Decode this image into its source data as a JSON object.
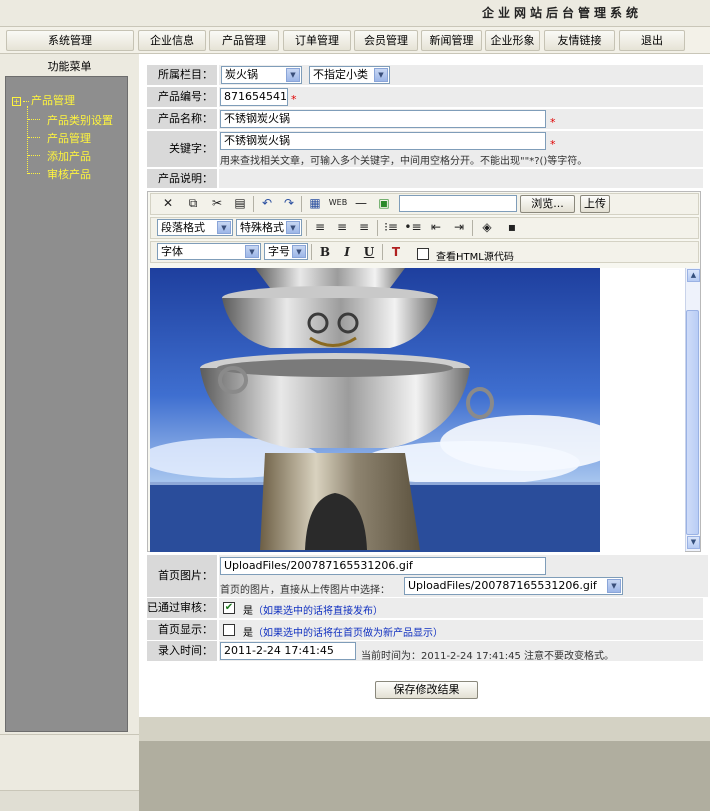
{
  "header": {
    "system_title": "企业网站后台管理系统"
  },
  "nav": {
    "items": [
      {
        "label": "系统管理"
      },
      {
        "label": "企业信息"
      },
      {
        "label": "产品管理"
      },
      {
        "label": "订单管理"
      },
      {
        "label": "会员管理"
      },
      {
        "label": "新闻管理"
      },
      {
        "label": "企业形象"
      },
      {
        "label": "友情链接"
      },
      {
        "label": "退出"
      }
    ]
  },
  "sidebar": {
    "title": "功能菜单",
    "root": {
      "label": "产品管理",
      "expander": "+"
    },
    "items": [
      {
        "label": "产品类别设置"
      },
      {
        "label": "产品管理"
      },
      {
        "label": "添加产品"
      },
      {
        "label": "审核产品"
      }
    ]
  },
  "form": {
    "category_label": "所属栏目：",
    "category_value": "炭火锅",
    "subcategory_value": "不指定小类",
    "code_label": "产品编号：",
    "code_value": "8716545416",
    "name_label": "产品名称：",
    "name_value": "不锈钢炭火锅",
    "keywords_label": "关键字：",
    "keywords_value": "不锈钢炭火锅",
    "keywords_hint": "用来查找相关文章，可输入多个关键字，中间用空格分开。不能出现\"\"*?()等字符。",
    "description_label": "产品说明：",
    "required_mark": "*",
    "image_label": "首页图片：",
    "image_value": "UploadFiles/200787165531206.gif",
    "image_hint": "首页的图片，直接从上传图片中选择：",
    "image_select_value": "UploadFiles/200787165531206.gif",
    "approved_label": "已通过审核：",
    "approved_checked": true,
    "approved_yes": "是",
    "approved_hint": "（如果选中的话将直接发布）",
    "homepage_label": "首页显示：",
    "homepage_checked": false,
    "homepage_yes": "是",
    "homepage_hint": "（如果选中的话将在首页做为新产品显示）",
    "time_label": "录入时间：",
    "time_value": "2011-2-24 17:41:45",
    "time_hint": "当前时间为：2011-2-24 17:41:45 注意不要改变格式。",
    "submit_label": "保存修改结果"
  },
  "editor": {
    "browse_label": "浏览...",
    "upload_label": "上传",
    "paragraph_select": "段落格式",
    "special_select": "特殊格式",
    "font_select": "字体",
    "size_select": "字号",
    "bold": "B",
    "italic": "I",
    "underline": "U",
    "view_html_label": "查看HTML源代码"
  }
}
